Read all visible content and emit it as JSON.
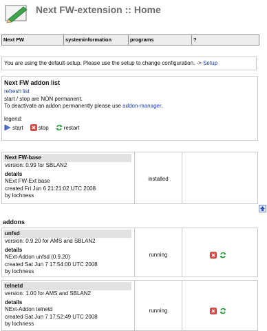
{
  "header": {
    "title": "Next FW-extension :: Home"
  },
  "nav": [
    "Next FW",
    "systeminformation",
    "programs",
    "?"
  ],
  "notice": {
    "text": "You are using the default-setup. Please use the setup to change configuration. ->",
    "link": "Setup"
  },
  "addon_list": {
    "title": "Next FW addon list",
    "refresh_link": "refresh list",
    "line1": "start / stop are NON permanent.",
    "line2": "To deactivate an addon permanently please use",
    "manager_link": "addon-manager",
    "line2_end": ".",
    "legend_label": "legend:",
    "legend": [
      "start",
      "stop",
      "restart"
    ]
  },
  "base": {
    "name": "Next FW-base",
    "version": "version: 0.99 for SBLAN2",
    "details_label": "details",
    "description": "NExt FW-Ext base",
    "created": "created Fri Jun 6 21:21:02 UTC 2008",
    "author": "by lochness",
    "status": "installed"
  },
  "addons_heading": "addons",
  "addons": [
    {
      "name": "unfsd",
      "version": "version: 0.9.20 for AMS and SBLAN2",
      "details_label": "details",
      "description": "NExt-Addon unfsd (0.9.20)",
      "created": "created Sat Jun 7 17:54:00 UTC 2008",
      "author": "by lochness",
      "status": "running"
    },
    {
      "name": "telnetd",
      "version": "version: 1.00 for AMS and SBLAN2",
      "details_label": "details",
      "description": "NExt-Addon telnetd",
      "created": "created Sat Jun 7 17:52:49 UTC 2008",
      "author": "by lochness",
      "status": "running"
    }
  ],
  "icons": {
    "start": "start-icon",
    "stop": "stop-icon",
    "restart": "restart-icon",
    "top": "arrow-up-icon",
    "logo": "edit-pencil-logo"
  },
  "colors": {
    "link": "#1a3fb0",
    "stop": "#cc2222",
    "restart": "#2a9a3a",
    "start": "#2f4fb5",
    "name_bar": "#e2e2e2"
  }
}
